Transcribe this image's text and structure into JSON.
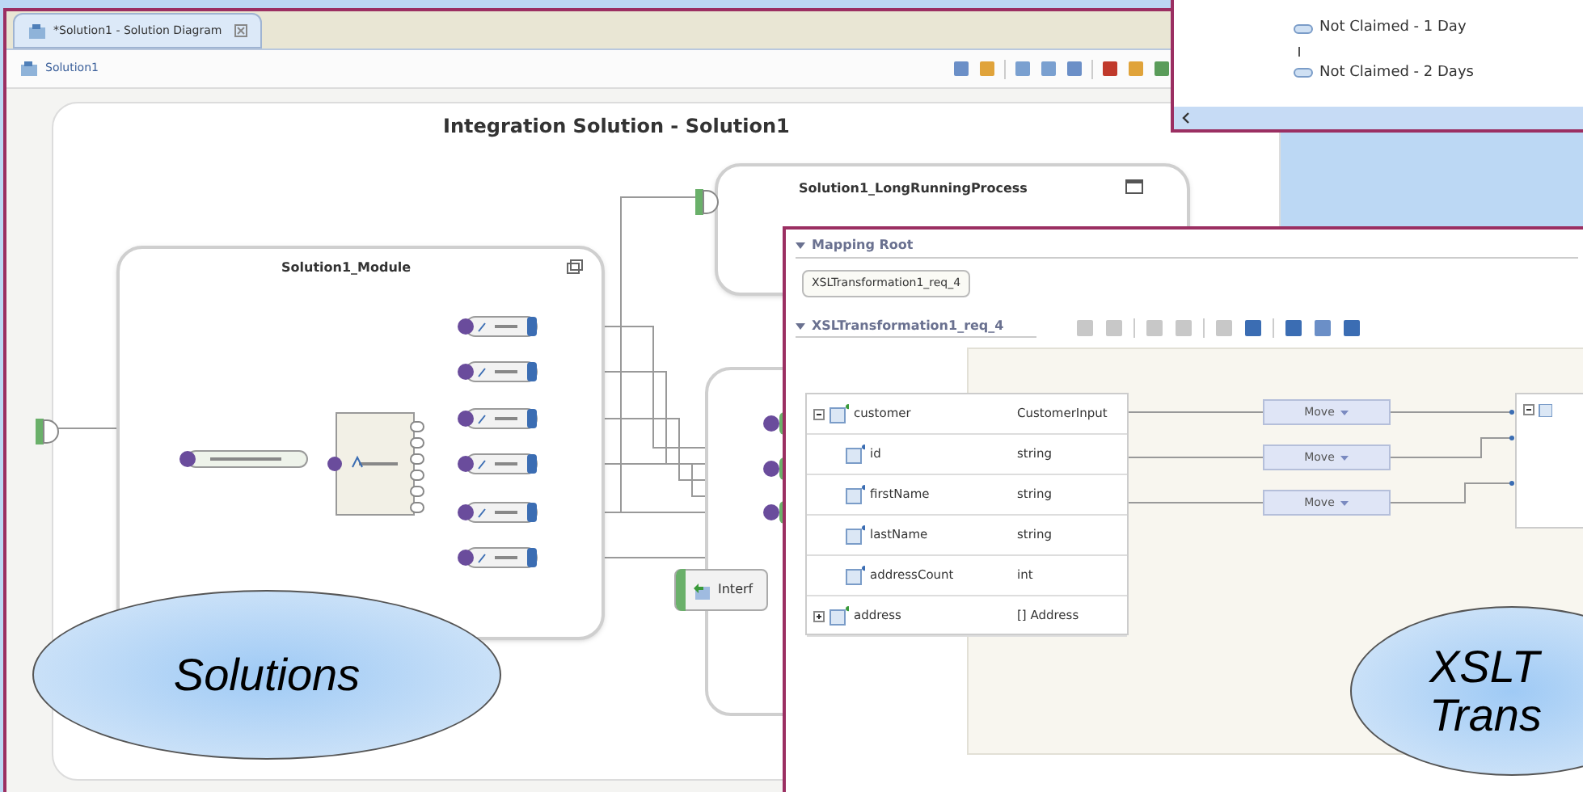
{
  "diagram_window": {
    "tab": "*Solution1 - Solution Diagram",
    "breadcrumb": "Solution1",
    "title": "Integration Solution - Solution1",
    "module": {
      "title": "Solution1_Module"
    },
    "process": {
      "title": "Solution1_LongRunningProcess"
    },
    "interface_node": "Interf"
  },
  "tasks_window": {
    "items": [
      "Not Claimed - 1 Day",
      "Not Claimed - 2 Days"
    ]
  },
  "mapping_window": {
    "section": "Mapping Root",
    "root_chip": "XSLTransformation1_req_4",
    "editor_title": "XSLTransformation1_req_4",
    "source_rows": [
      {
        "kind": "group",
        "expanded": true,
        "name": "customer",
        "type": "CustomerInput"
      },
      {
        "kind": "field",
        "name": "id",
        "type": "string"
      },
      {
        "kind": "field",
        "name": "firstName",
        "type": "string"
      },
      {
        "kind": "field",
        "name": "lastName",
        "type": "string"
      },
      {
        "kind": "field",
        "name": "addressCount",
        "type": "int"
      },
      {
        "kind": "group",
        "expanded": false,
        "name": "address",
        "type": "[] Address"
      }
    ],
    "moves": [
      "Move",
      "Move",
      "Move"
    ]
  },
  "callouts": [
    {
      "lines": [
        "Solutions"
      ]
    },
    {
      "lines": [
        "XSLT",
        "Trans"
      ]
    }
  ]
}
